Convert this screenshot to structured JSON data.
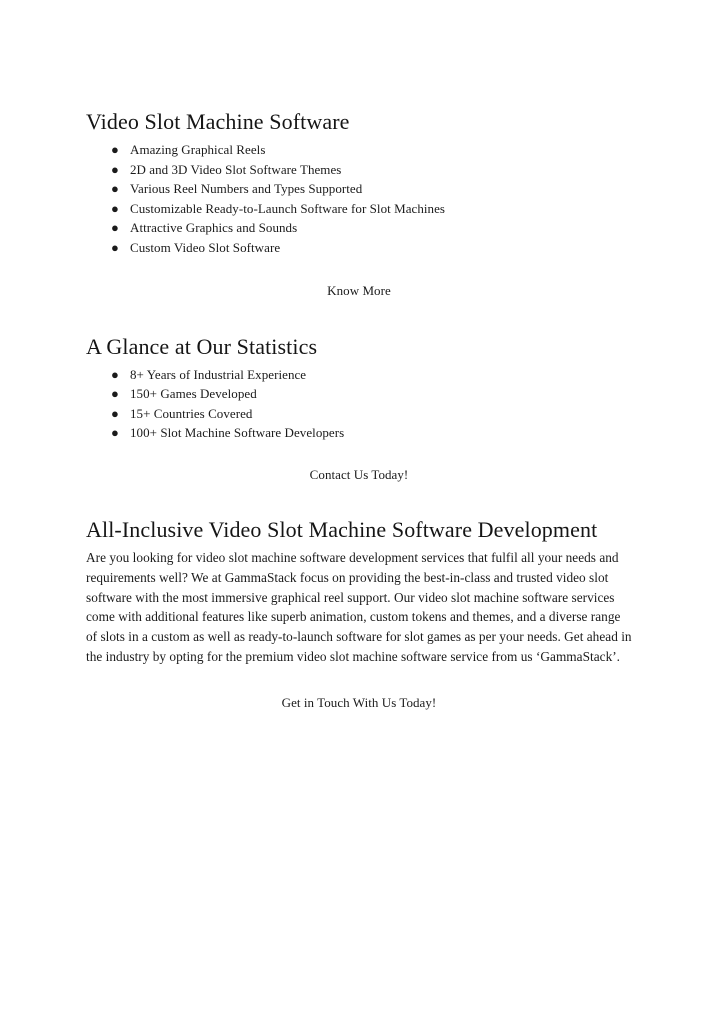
{
  "document": {
    "sections": [
      {
        "heading": "Video Slot Machine Software",
        "bullets": [
          "Amazing Graphical Reels",
          "2D and 3D Video Slot Software Themes",
          "Various Reel Numbers and Types Supported",
          "Customizable Ready-to-Launch Software for Slot Machines",
          "Attractive Graphics and Sounds",
          "Custom Video Slot Software"
        ],
        "cta": "Know More"
      },
      {
        "heading": "A Glance at Our Statistics",
        "bullets": [
          "8+ Years of Industrial Experience",
          "150+ Games Developed",
          "15+ Countries Covered",
          "100+ Slot Machine Software Developers"
        ],
        "cta": "Contact Us Today!"
      },
      {
        "heading": "All-Inclusive Video Slot Machine Software Development",
        "paragraph": "Are you looking for video slot machine software development services that fulfil all your needs and requirements well? We at GammaStack focus on providing the best-in-class and trusted video slot software with the most immersive graphical reel support. Our video slot machine software services come with additional features like superb animation, custom tokens and themes, and a diverse range of slots in a custom as well as ready-to-launch software for slot games as per your needs. Get ahead in the industry by opting for the premium video slot machine software service from us ‘GammaStack’.",
        "cta": "Get in Touch With Us Today!"
      }
    ],
    "bullet_marker": "●",
    "colors": {
      "text": "#1b1b1b",
      "heading": "#151515",
      "background": "#ffffff"
    }
  }
}
